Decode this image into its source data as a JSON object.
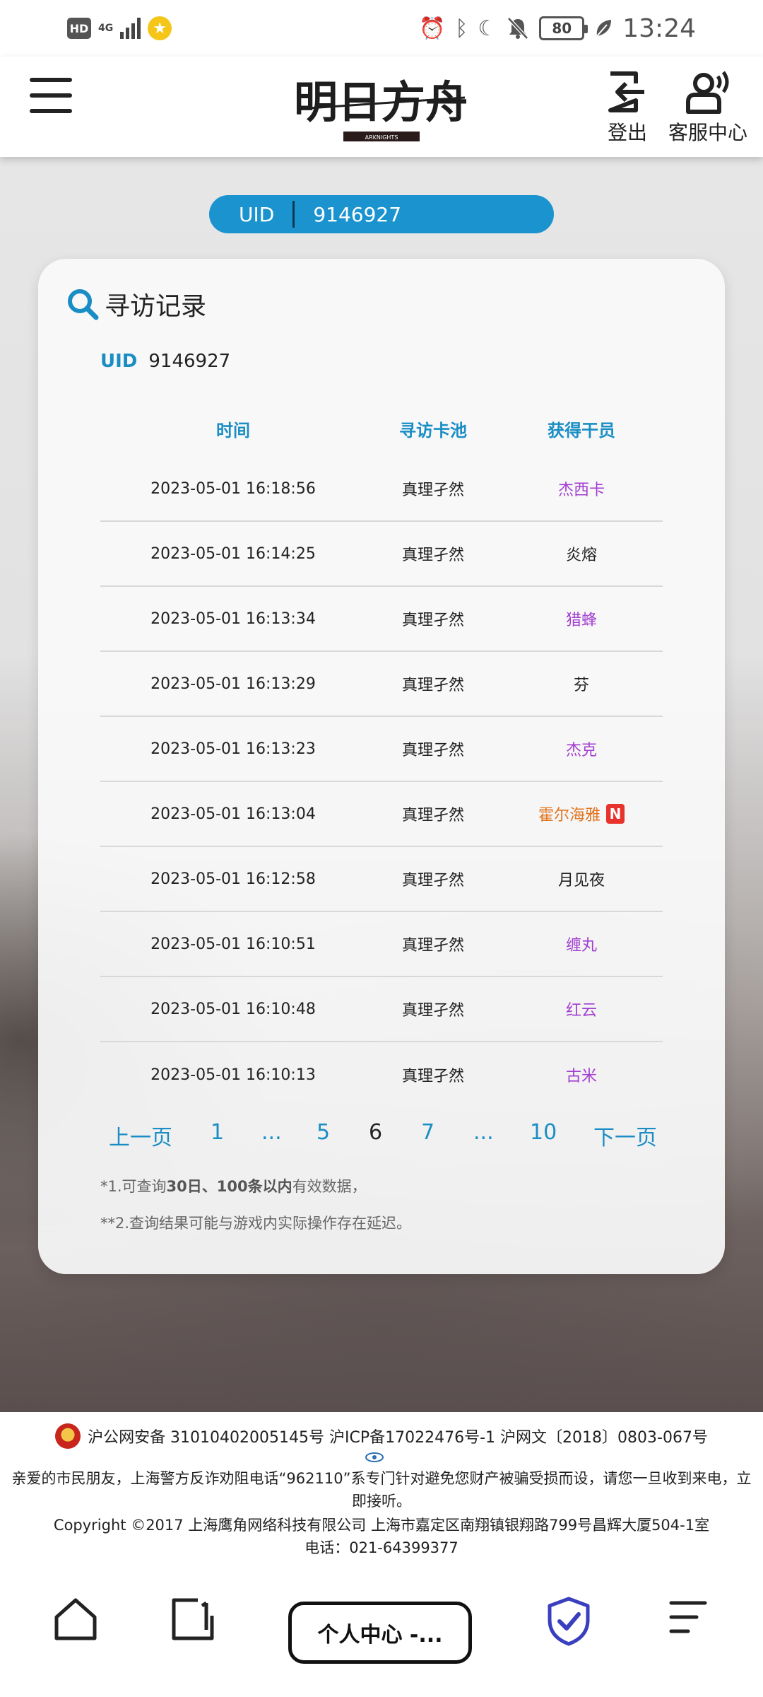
{
  "status_bar": {
    "hd": "HD",
    "network": "4G",
    "battery": "80",
    "time": "13:24"
  },
  "header": {
    "logo_text": "明日方舟",
    "logo_sub": "ARKNIGHTS",
    "logout_label": "登出",
    "service_label": "客服中心"
  },
  "uid_pill": {
    "key": "UID",
    "value": "9146927"
  },
  "record": {
    "title": "寻访记录",
    "uid_key": "UID",
    "uid_value": "9146927",
    "columns": [
      "时间",
      "寻访卡池",
      "获得干员"
    ],
    "rows": [
      {
        "time": "2023-05-01 16:18:56",
        "pool": "真理孑然",
        "operator": "杰西卡",
        "rarity": "5",
        "new": ""
      },
      {
        "time": "2023-05-01 16:14:25",
        "pool": "真理孑然",
        "operator": "炎熔",
        "rarity": "4",
        "new": ""
      },
      {
        "time": "2023-05-01 16:13:34",
        "pool": "真理孑然",
        "operator": "猎蜂",
        "rarity": "5",
        "new": ""
      },
      {
        "time": "2023-05-01 16:13:29",
        "pool": "真理孑然",
        "operator": "芬",
        "rarity": "4",
        "new": ""
      },
      {
        "time": "2023-05-01 16:13:23",
        "pool": "真理孑然",
        "operator": "杰克",
        "rarity": "5",
        "new": ""
      },
      {
        "time": "2023-05-01 16:13:04",
        "pool": "真理孑然",
        "operator": "霍尔海雅",
        "rarity": "6",
        "new": "N"
      },
      {
        "time": "2023-05-01 16:12:58",
        "pool": "真理孑然",
        "operator": "月见夜",
        "rarity": "4",
        "new": ""
      },
      {
        "time": "2023-05-01 16:10:51",
        "pool": "真理孑然",
        "operator": "缠丸",
        "rarity": "5",
        "new": ""
      },
      {
        "time": "2023-05-01 16:10:48",
        "pool": "真理孑然",
        "operator": "红云",
        "rarity": "5",
        "new": ""
      },
      {
        "time": "2023-05-01 16:10:13",
        "pool": "真理孑然",
        "operator": "古米",
        "rarity": "5",
        "new": ""
      }
    ],
    "pagination": {
      "prev": "上一页",
      "p1": "1",
      "e1": "...",
      "p5": "5",
      "p6": "6",
      "p7": "7",
      "e2": "...",
      "p10": "10",
      "next": "下一页"
    },
    "note1_pre": "*1.可查询",
    "note1_bold": "30日、100条以内",
    "note1_post": "有效数据，",
    "note2": "**2.查询结果可能与游戏内实际操作存在延迟。"
  },
  "footer": {
    "line1": "沪公网安备 31010402005145号  沪ICP备17022476号-1  沪网文〔2018〕0803-067号",
    "line2": "亲爱的市民朋友，上海警方反诈劝阻电话“962110”系专门针对避免您财产被骗受损而设，请您一旦收到来电，立即接听。",
    "line3": "Copyright ©2017 上海鹰角网络科技有限公司  上海市嘉定区南翔镇银翔路799号昌辉大厦504-1室",
    "line4": "电话：021-64399377"
  },
  "browser_bar": {
    "page_title": "个人中心 -..."
  },
  "colors": {
    "accent": "#1a8ec4",
    "pill": "#1a93cf",
    "rarity_5": "#a23ed0",
    "rarity_6": "#e0731b",
    "new_badge": "#e8332d"
  },
  "icons": [
    "alarm-icon",
    "bluetooth-icon",
    "moon-icon",
    "bell-off-icon",
    "leaf-icon",
    "menu-icon",
    "logout-icon",
    "service-icon",
    "search-icon",
    "home-icon",
    "tabs-icon",
    "shield-check-icon",
    "browser-menu-icon"
  ]
}
